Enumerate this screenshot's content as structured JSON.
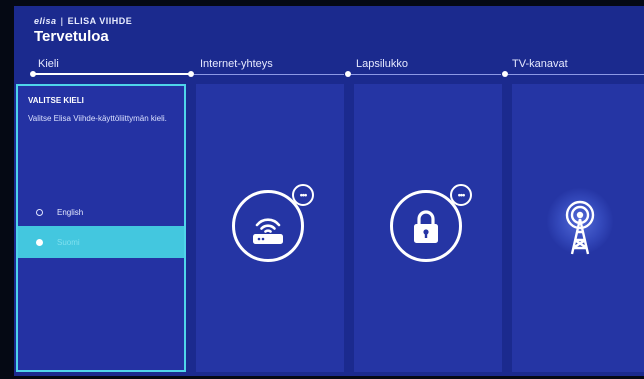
{
  "header": {
    "brand_logo": "elisa",
    "brand_separator": "|",
    "brand_name": "ELISA VIIHDE",
    "title": "Tervetuloa"
  },
  "steps": [
    {
      "label": "Kieli",
      "active": true
    },
    {
      "label": "Internet-yhteys",
      "active": false
    },
    {
      "label": "Lapsilukko",
      "active": false
    },
    {
      "label": "TV-kanavat",
      "active": false
    }
  ],
  "language_panel": {
    "heading": "VALITSE KIELI",
    "description": "Valitse Elisa Viihde-käyttöliittymän kieli.",
    "options": [
      {
        "label": "English",
        "selected": false
      },
      {
        "label": "Suomi",
        "selected": true
      }
    ]
  },
  "panels": {
    "internet": {
      "icon": "router-wifi-icon",
      "badge": "•••"
    },
    "parental": {
      "icon": "padlock-icon",
      "badge": "•••"
    },
    "tv": {
      "icon": "broadcast-tower-icon"
    }
  },
  "colors": {
    "background": "#1b2a8e",
    "panel": "#2535a4",
    "accent": "#4fd5ea",
    "selected_row": "#43c7df"
  }
}
